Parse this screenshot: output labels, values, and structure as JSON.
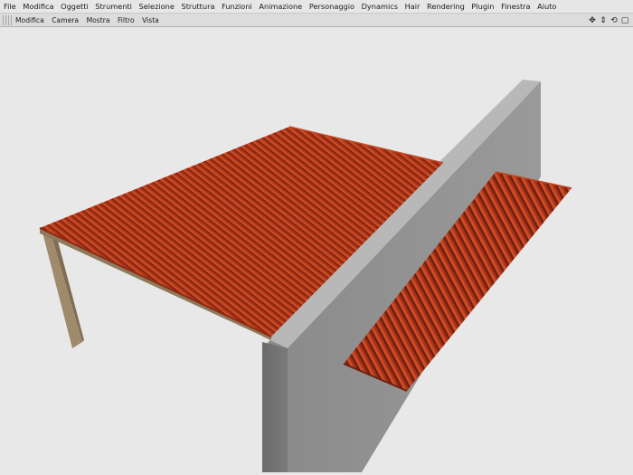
{
  "menu": {
    "items": [
      "File",
      "Modifica",
      "Oggetti",
      "Strumenti",
      "Selezione",
      "Struttura",
      "Funzioni",
      "Animazione",
      "Personaggio",
      "Dynamics",
      "Hair",
      "Rendering",
      "Plugin",
      "Finestra",
      "Aiuto"
    ]
  },
  "view_menu": {
    "items": [
      "Modifica",
      "Camera",
      "Mostra",
      "Filtro",
      "Vista"
    ]
  },
  "nav_icons": [
    "move-icon",
    "zoom-icon",
    "rotate-icon",
    "maximize-icon"
  ],
  "colors": {
    "roof_tile": "#b53a18",
    "wall": "#8e8e8e",
    "post": "#a08a6c",
    "background": "#e8e8e8"
  }
}
